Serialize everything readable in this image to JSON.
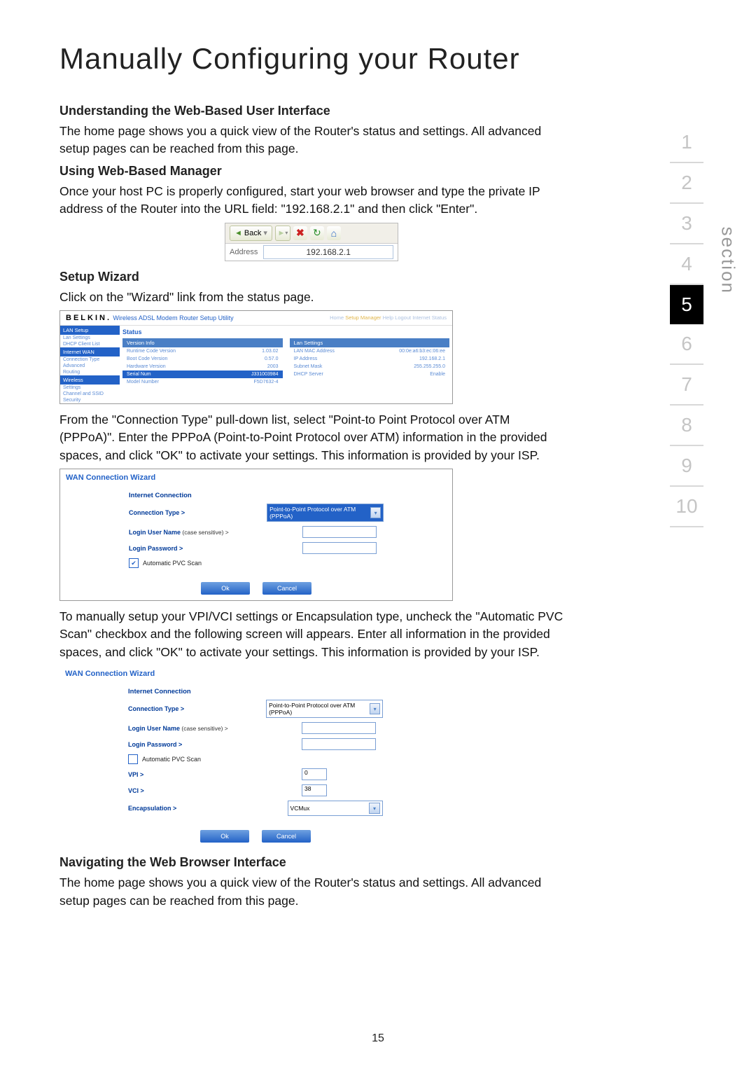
{
  "title": "Manually Configuring your Router",
  "s1": {
    "h": "Understanding the Web-Based User Interface",
    "p": "The home page shows you a quick view of the Router's status and settings. All advanced setup pages can be reached from this page."
  },
  "s2": {
    "h": "Using Web-Based Manager",
    "p": "Once your host PC is properly configured, start your web browser and type the private IP address of the Router into the URL field: \"192.168.2.1\" and then click \"Enter\"."
  },
  "toolbar": {
    "back": "Back",
    "addr_label": "Address",
    "addr": "192.168.2.1"
  },
  "s3": {
    "h": "Setup Wizard",
    "p": "Click on the \"Wizard\" link from the status page."
  },
  "status_panel": {
    "logo": "BELKIN.",
    "title": "Wireless ADSL Modem Router Setup Utility",
    "links": {
      "home": "Home",
      "sm": "Setup Manager",
      "help": "Help",
      "logout": "Logout",
      "is": "Internet Status"
    },
    "nav": {
      "h1": "LAN Setup",
      "a1": "Lan Settings",
      "a2": "DHCP Client List",
      "h2": "Internet WAN",
      "a3": "Connection Type",
      "a4": "Advanced",
      "a5": "Routing",
      "h3": "Wireless",
      "a6": "Settings",
      "a7": "Channel and SSID",
      "a8": "Security"
    },
    "status": "Status",
    "left": {
      "h": "Version Info",
      "r1": [
        "Runtime Code Version",
        "1.03.02"
      ],
      "r2": [
        "Boot Code Version",
        "0.57.0"
      ],
      "r3": [
        "Hardware Version",
        "2003"
      ],
      "r4": [
        "Serial Num",
        "J331003984"
      ],
      "r5": [
        "Model Number",
        "F5D7632-4"
      ]
    },
    "right": {
      "h": "Lan Settings",
      "r1": [
        "LAN MAC Address",
        "00:0e:a6:b3:ec:06:ee"
      ],
      "r2": [
        "IP Address",
        "192.168.2.1"
      ],
      "r3": [
        "Subnet Mask",
        "255.255.255.0"
      ],
      "r4": [
        "DHCP Server",
        "Enable"
      ]
    }
  },
  "s4": {
    "p": "From the \"Connection Type\" pull-down list, select \"Point-to Point Protocol over ATM (PPPoA)\". Enter the PPPoA (Point-to-Point Protocol over ATM) information in the provided spaces, and click \"OK\" to activate your settings. This information is provided by your ISP."
  },
  "wiz": {
    "title": "WAN Connection Wizard",
    "ic": "Internet Connection",
    "ct": "Connection Type >",
    "ct_val": "Point-to-Point Protocol over ATM (PPPoA)",
    "user": "Login User Name",
    "user_note": " (case sensitive) >",
    "pass": "Login Password >",
    "pvc": "Automatic PVC Scan",
    "vpi": "VPI >",
    "vpi_val": "0",
    "vci": "VCI >",
    "vci_val": "38",
    "enc": "Encapsulation >",
    "enc_val": "VCMux",
    "ok": "Ok",
    "cancel": "Cancel"
  },
  "s5": {
    "p": "To manually setup your VPI/VCI settings or Encapsulation type, uncheck the \"Automatic PVC Scan\" checkbox and the following screen will appears. Enter all information in the provided spaces, and click \"OK\" to activate your settings. This information is provided by your ISP."
  },
  "s6": {
    "h": "Navigating the Web Browser Interface",
    "p": "The home page shows you a quick view of the Router's status and settings. All advanced setup pages can be reached from this page."
  },
  "sections": [
    "1",
    "2",
    "3",
    "4",
    "5",
    "6",
    "7",
    "8",
    "9",
    "10"
  ],
  "section_label": "section",
  "page_num": "15"
}
